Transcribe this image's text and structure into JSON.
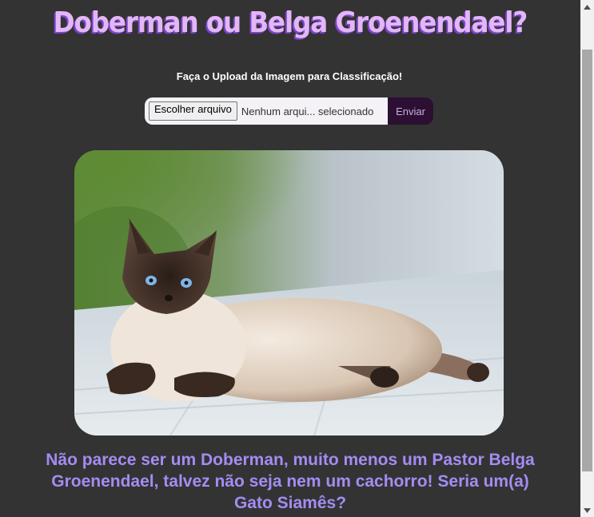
{
  "header": {
    "title": "Doberman ou Belga Groenendael?"
  },
  "upload": {
    "instruction": "Faça o Upload da Imagem para Classificação!",
    "choose_file_label": "Escolher arquivo",
    "file_status": "Nenhum arqui... selecionado",
    "submit_label": "Enviar"
  },
  "result": {
    "line1": "Não parece ser um Doberman, muito menos um Pastor Belga",
    "line2": "Groenendael, talvez não seja nem um cachorro! Seria um(a)",
    "line3": "Gato Siamês?"
  },
  "colors": {
    "background": "#333333",
    "title": "#e3b6f7",
    "title_shadow": "#7a45c8",
    "result_text": "#a48cf2",
    "submit_bg": "#2c0f33"
  },
  "icons": {
    "scroll_up": "triangle-up-icon",
    "scroll_down": "triangle-down-icon"
  }
}
